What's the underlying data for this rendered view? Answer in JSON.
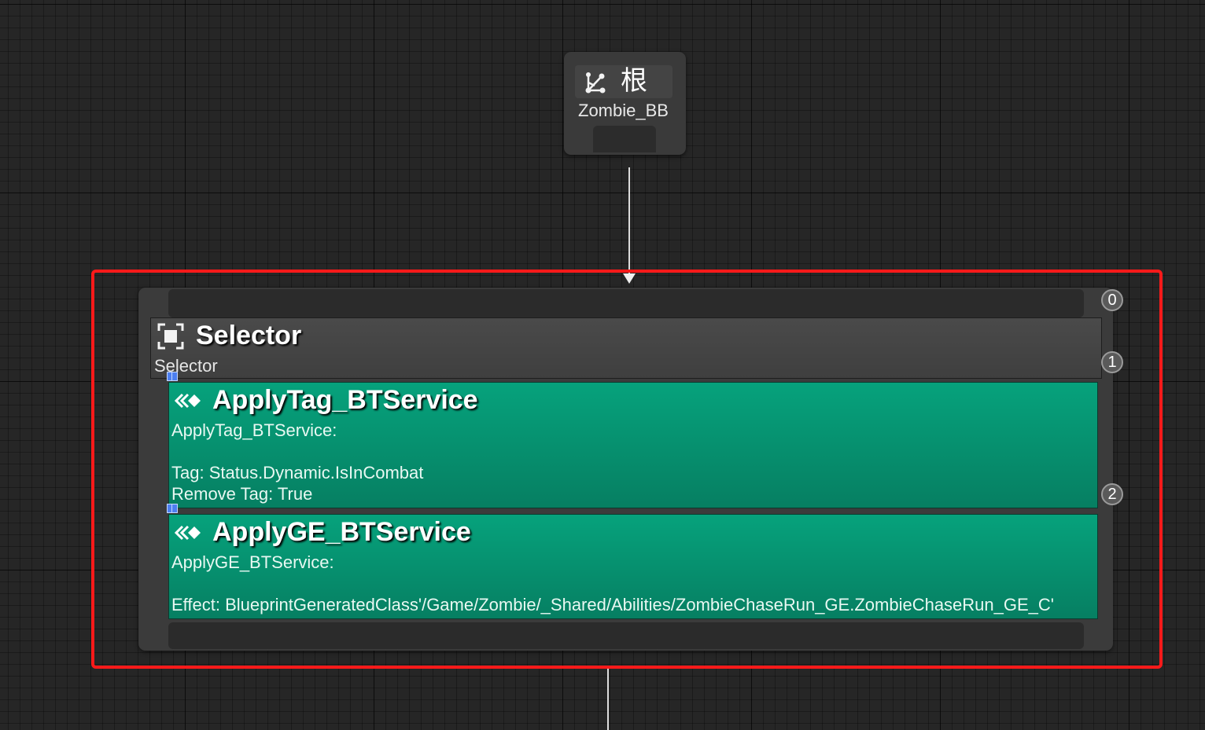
{
  "root_node": {
    "icon": "behavior-tree-root-icon",
    "title": "根",
    "blackboard": "Zombie_BB"
  },
  "selector_node": {
    "icon": "selector-composite-icon",
    "title": "Selector",
    "subtitle": "Selector",
    "services": [
      {
        "icon": "service-icon",
        "title": "ApplyTag_BTService",
        "lines": [
          "ApplyTag_BTService:",
          "",
          "Tag: Status.Dynamic.IsInCombat",
          "Remove Tag: True"
        ]
      },
      {
        "icon": "service-icon",
        "title": "ApplyGE_BTService",
        "lines": [
          "ApplyGE_BTService:",
          "",
          "Effect: BlueprintGeneratedClass'/Game/Zombie/_Shared/Abilities/ZombieChaseRun_GE.ZombieChaseRun_GE_C'"
        ]
      }
    ]
  },
  "execution_badges": [
    "0",
    "1",
    "2"
  ],
  "colors": {
    "graph_background": "#262626",
    "node_body": "#3b3b3b",
    "service_green": "#06a27c",
    "highlight_red": "#ff1a1a",
    "wire": "#dcdcdc"
  }
}
